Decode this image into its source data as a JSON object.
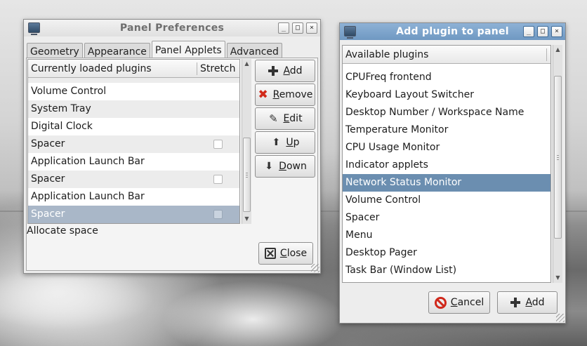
{
  "panel_prefs": {
    "title": "Panel Preferences",
    "window_buttons": [
      "_",
      "□",
      "×"
    ],
    "tabs": [
      {
        "label": "Geometry"
      },
      {
        "label": "Appearance"
      },
      {
        "label": "Panel Applets"
      },
      {
        "label": "Advanced"
      }
    ],
    "active_tab": "Panel Applets",
    "list": {
      "col_plugins": "Currently loaded plugins",
      "col_stretch": "Stretch",
      "rows": [
        {
          "name": "Volume Control",
          "stretch_checkbox": false
        },
        {
          "name": "System Tray",
          "stretch_checkbox": false
        },
        {
          "name": "Digital Clock",
          "stretch_checkbox": false
        },
        {
          "name": "Spacer",
          "stretch_checkbox": true
        },
        {
          "name": "Application Launch Bar",
          "stretch_checkbox": false
        },
        {
          "name": "Spacer",
          "stretch_checkbox": true
        },
        {
          "name": "Application Launch Bar",
          "stretch_checkbox": false
        },
        {
          "name": "Spacer",
          "stretch_checkbox": true,
          "selected": true
        }
      ]
    },
    "buttons": {
      "add_pre": "",
      "add_u": "A",
      "add_post": "dd",
      "remove_pre": "",
      "remove_u": "R",
      "remove_post": "emove",
      "edit_pre": "",
      "edit_u": "E",
      "edit_post": "dit",
      "up_pre": "",
      "up_u": "U",
      "up_post": "p",
      "down_pre": "",
      "down_u": "D",
      "down_post": "own",
      "close_pre": "",
      "close_u": "C",
      "close_post": "lose"
    },
    "status": "Allocate space"
  },
  "add_plugin": {
    "title": "Add plugin to panel",
    "window_buttons": [
      "_",
      "□",
      "×"
    ],
    "list_header": "Available plugins",
    "rows": [
      {
        "name": "CPUFreq frontend"
      },
      {
        "name": "Keyboard Layout Switcher"
      },
      {
        "name": "Desktop Number / Workspace Name"
      },
      {
        "name": "Temperature Monitor"
      },
      {
        "name": "CPU Usage Monitor"
      },
      {
        "name": "Indicator applets"
      },
      {
        "name": "Network Status Monitor",
        "selected": true
      },
      {
        "name": "Volume Control"
      },
      {
        "name": "Spacer"
      },
      {
        "name": "Menu"
      },
      {
        "name": "Desktop Pager"
      },
      {
        "name": "Task Bar (Window List)"
      }
    ],
    "buttons": {
      "cancel_pre": "",
      "cancel_u": "C",
      "cancel_post": "ancel",
      "add_pre": "",
      "add_u": "A",
      "add_post": "dd"
    }
  }
}
